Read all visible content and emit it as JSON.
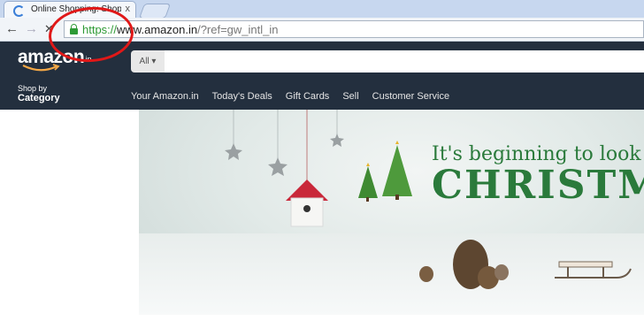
{
  "browser": {
    "tab_title": "Online Shopping: Shop Onl...",
    "tab_close": "x",
    "url_scheme": "https://",
    "url_host": "www.amazon.in",
    "url_path": "/?ref=gw_intl_in"
  },
  "header": {
    "logo_text": "amazon",
    "logo_suffix": ".in",
    "search_scope": "All ▾",
    "search_placeholder": "",
    "shop_by": "Shop by",
    "category": "Category",
    "nav_links": [
      "Your Amazon.in",
      "Today's Deals",
      "Gift Cards",
      "Sell",
      "Customer Service"
    ]
  },
  "banner": {
    "headline_1": "It's beginning to look a l",
    "headline_2": "CHRISTM"
  },
  "colors": {
    "header_bg": "#232f3e",
    "banner_green": "#2a7a3b",
    "annotation_red": "#e01818"
  }
}
